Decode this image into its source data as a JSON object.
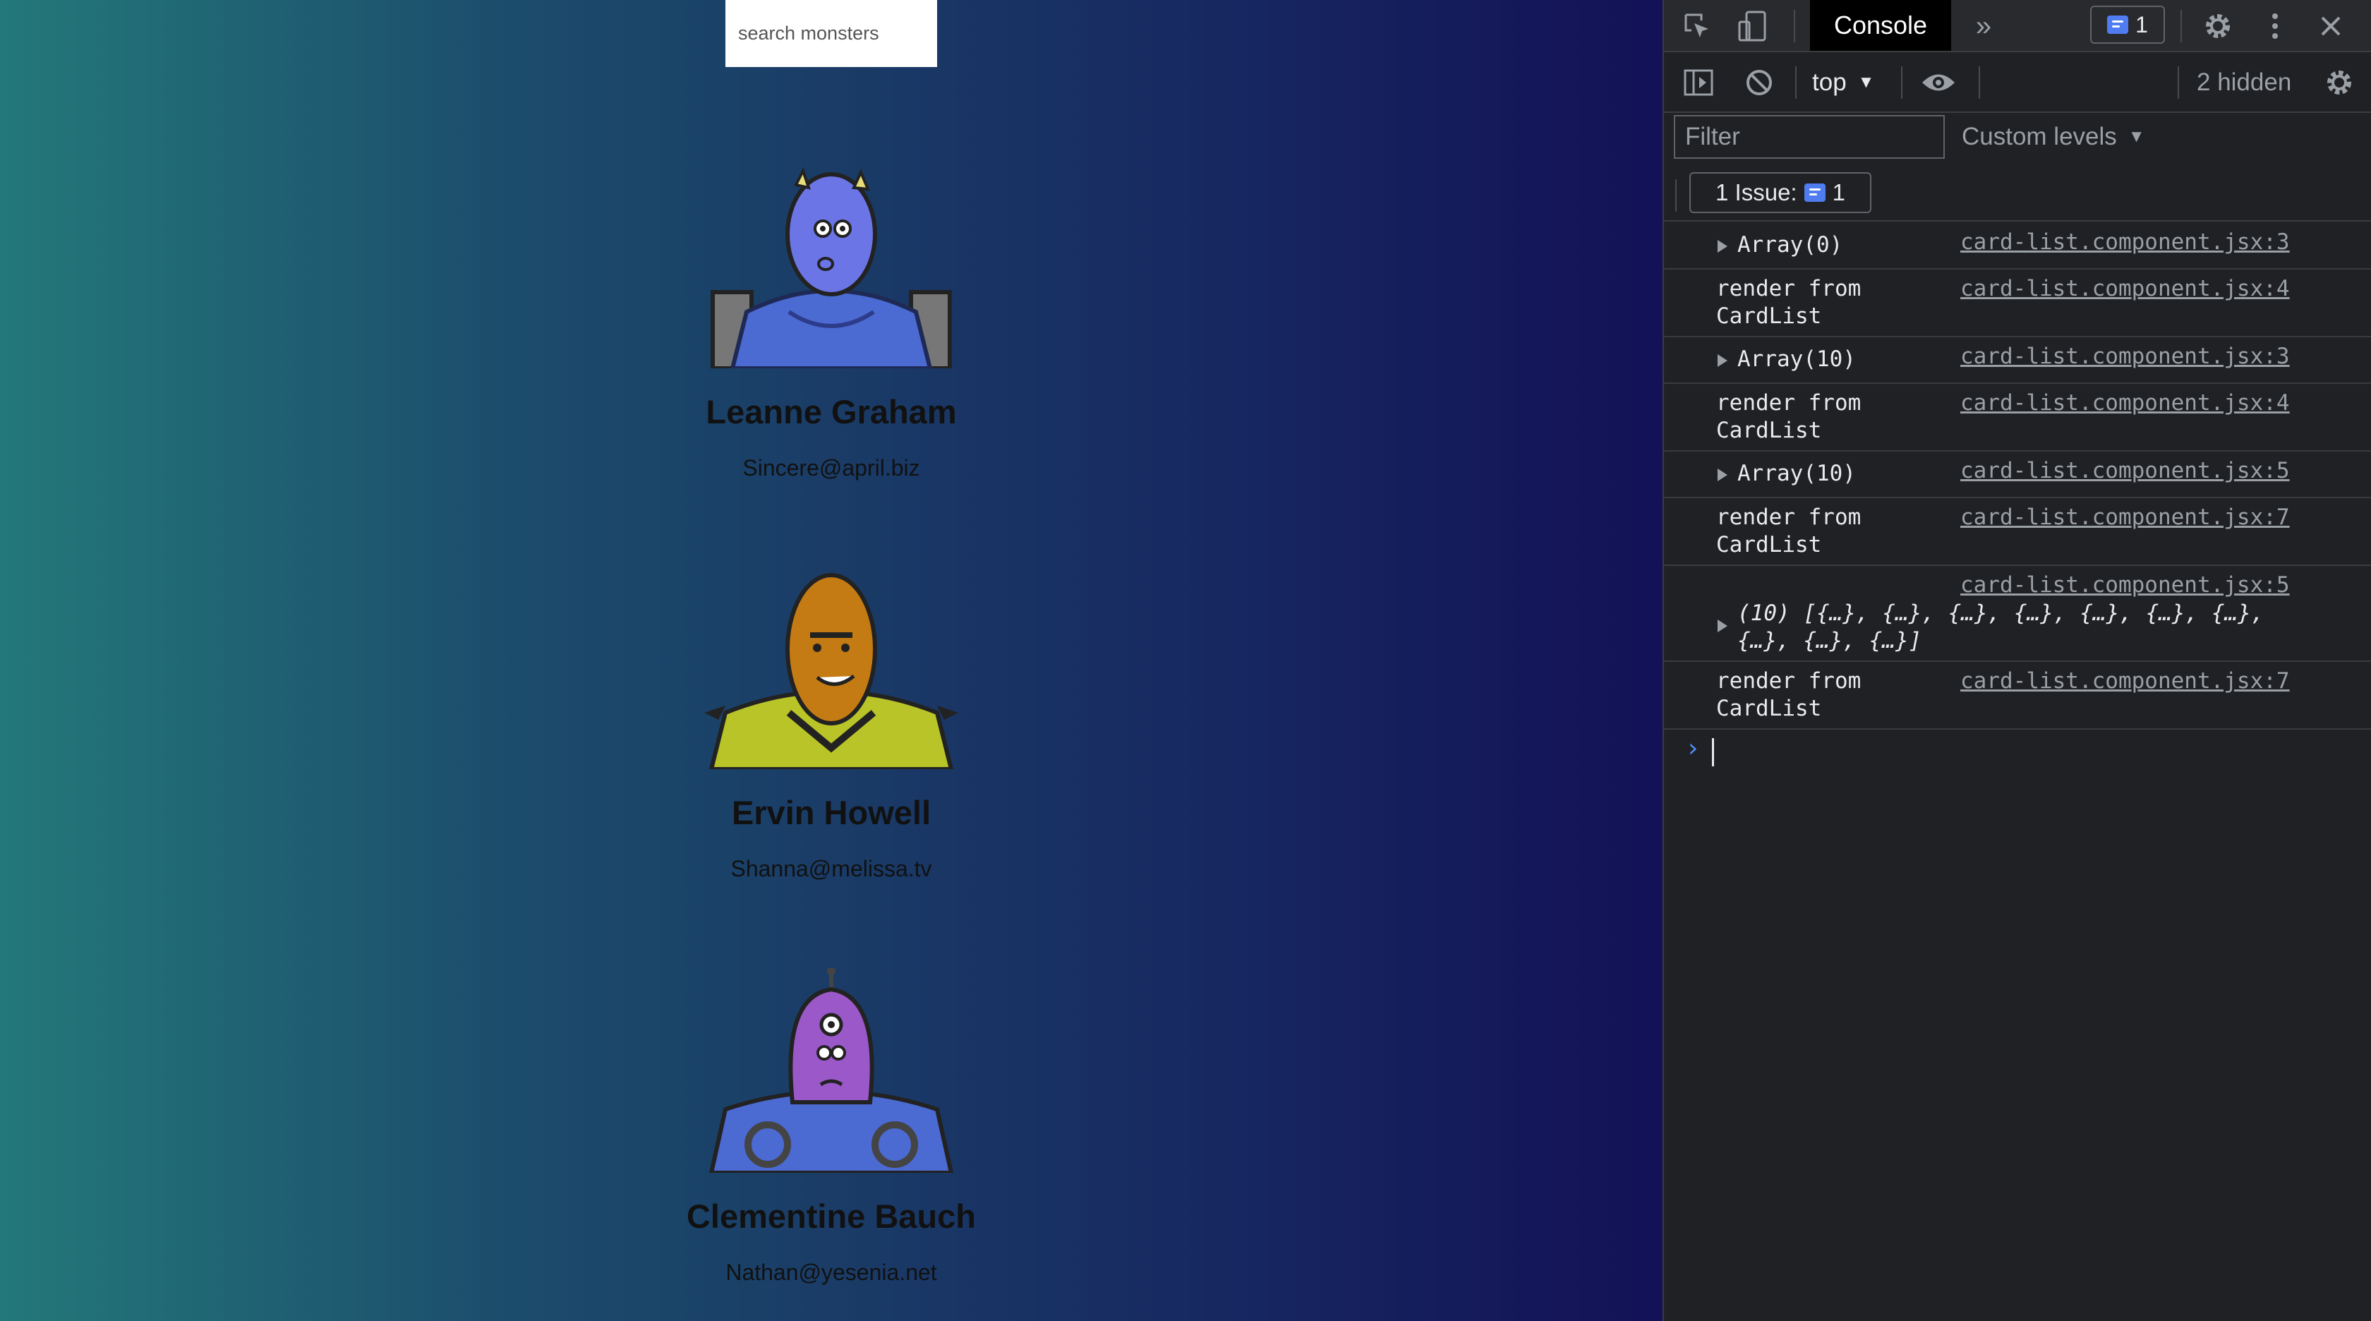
{
  "app": {
    "search_placeholder": "search monsters",
    "monsters": [
      {
        "name": "Leanne Graham",
        "email": "Sincere@april.biz"
      },
      {
        "name": "Ervin Howell",
        "email": "Shanna@melissa.tv"
      },
      {
        "name": "Clementine Bauch",
        "email": "Nathan@yesenia.net"
      }
    ]
  },
  "devtools": {
    "tab_console": "Console",
    "issues_count": "1",
    "context": "top",
    "hidden": "2 hidden",
    "filter_placeholder": "Filter",
    "custom_levels": "Custom levels",
    "issues_label": "1 Issue:",
    "issues_badge_count": "1",
    "messages": [
      {
        "text": "Array(0)",
        "source": "card-list.component.jsx:3"
      },
      {
        "text": "render from\nCardList",
        "source": "card-list.component.jsx:4"
      },
      {
        "text": "Array(10)",
        "source": "card-list.component.jsx:3"
      },
      {
        "text": "render from\nCardList",
        "source": "card-list.component.jsx:4"
      },
      {
        "text": "Array(10)",
        "source": "card-list.component.jsx:5"
      },
      {
        "text": "render from\nCardList",
        "source": "card-list.component.jsx:7"
      },
      {
        "text": "(10) [{…}, {…}, {…}, {…}, {…}, {…}, {…},\n{…}, {…}, {…}]",
        "source": "card-list.component.jsx:5"
      },
      {
        "text": "render from\nCardList",
        "source": "card-list.component.jsx:7"
      }
    ],
    "prompt_symbol": "›",
    "accent": "#4f7cf0"
  }
}
